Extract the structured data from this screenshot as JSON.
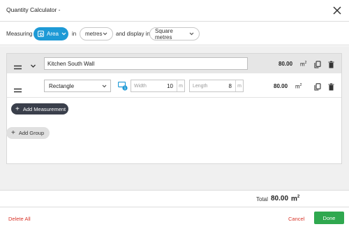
{
  "dialog": {
    "title": "Quantity Calculator -"
  },
  "measuring": {
    "measuring_label": "Measuring",
    "type_value": "Area",
    "in_label": "in",
    "unit_value": "metres",
    "display_label": "and display in",
    "display_value": "Square metres",
    "accent_color": "#1e9ad6"
  },
  "group": {
    "name": "Kitchen South Wall",
    "total": "80.00",
    "unit": "m",
    "unit_sup": "2"
  },
  "measurement": {
    "shape": "Rectangle",
    "badge_count": "1",
    "width_placeholder": "Width",
    "width_value": "10",
    "width_unit": "m",
    "length_placeholder": "Length",
    "length_value": "8",
    "length_unit": "m",
    "total": "80.00",
    "unit": "m",
    "unit_sup": "2"
  },
  "buttons": {
    "add_measurement": "Add Measurement",
    "add_group": "Add Group",
    "delete_all": "Delete All",
    "cancel": "Cancel",
    "done": "Done"
  },
  "total": {
    "label": "Total",
    "value": "80.00",
    "unit": "m",
    "unit_sup": "2"
  },
  "icons": {
    "close": "close-icon",
    "drag": "drag-handle-icon",
    "expand": "chevron-down-icon",
    "copy": "copy-icon",
    "delete": "trash-icon",
    "dimension": "dimension-icon"
  },
  "colors": {
    "danger": "#d9362b",
    "success": "#2fa84f",
    "dark_button": "#3a3f4b"
  }
}
